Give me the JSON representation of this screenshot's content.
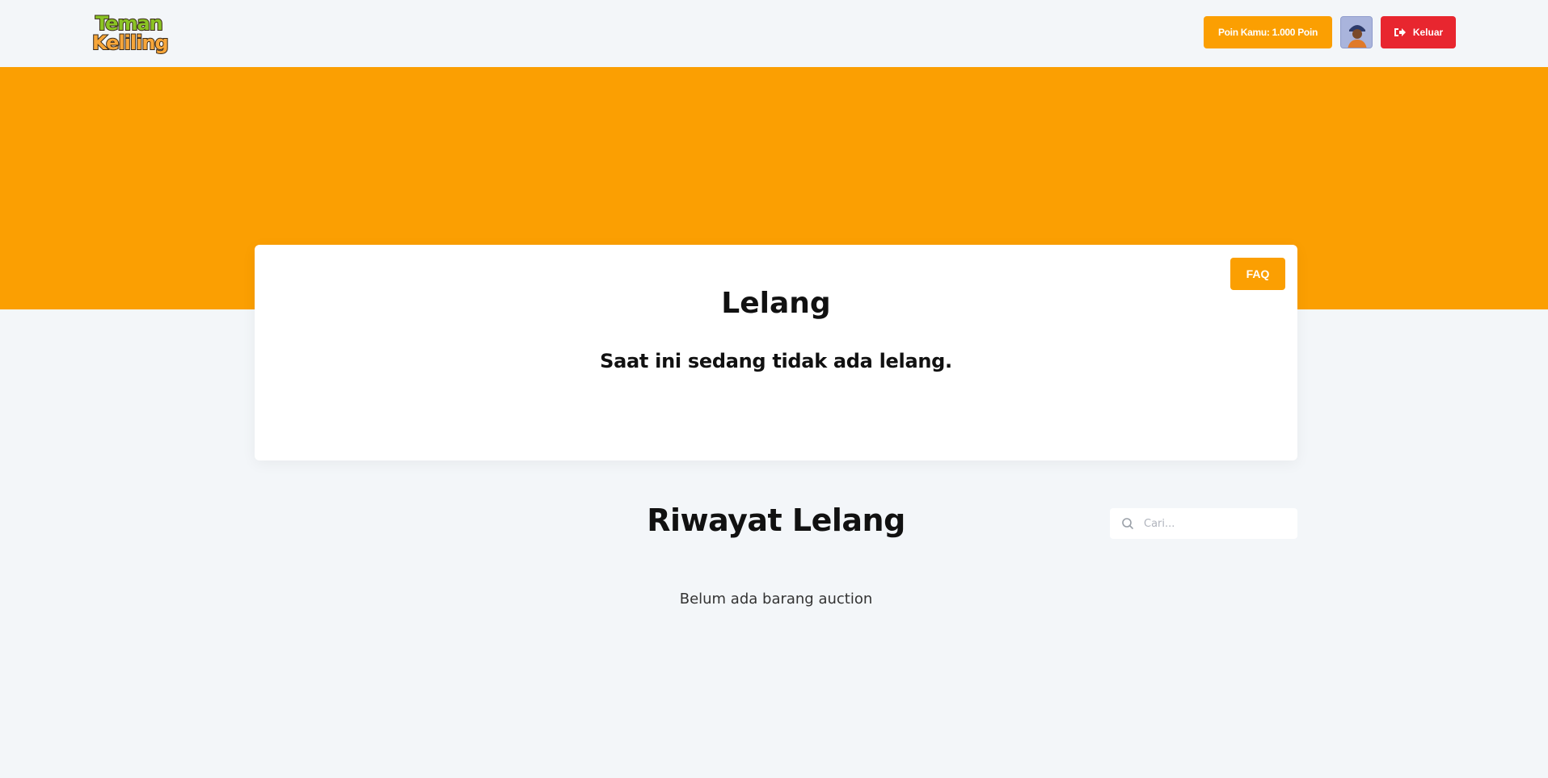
{
  "header": {
    "logo": {
      "line1": "Teman",
      "line2": "Keliling"
    },
    "points_label": "Poin Kamu: 1.000 Poin",
    "logout_label": "Keluar"
  },
  "auction": {
    "title": "Lelang",
    "faq_label": "FAQ",
    "empty_message": "Saat ini sedang tidak ada lelang."
  },
  "history": {
    "title": "Riwayat Lelang",
    "search_placeholder": "Cari...",
    "empty_message": "Belum ada barang auction"
  },
  "colors": {
    "accent": "#fb9f02",
    "danger": "#e8262f",
    "background": "#f3f6f9"
  },
  "icons": [
    "logout-icon",
    "search-icon",
    "avatar"
  ]
}
